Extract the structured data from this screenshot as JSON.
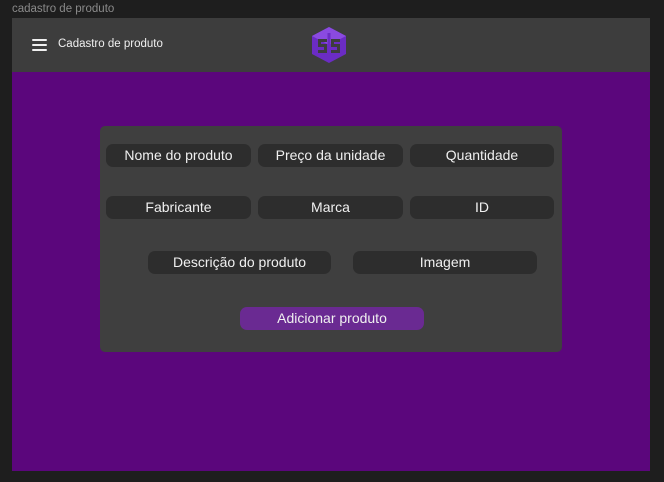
{
  "frame": {
    "title": "cadastro de produto"
  },
  "navbar": {
    "title": "Cadastro de produto",
    "menu_icon": "hamburger-menu-icon",
    "logo_icon": "brand-logo-icon",
    "background": "#3d3d3d"
  },
  "page": {
    "background": "#5b067c"
  },
  "form": {
    "fields": [
      {
        "label": "Nome do produto"
      },
      {
        "label": "Preço da unidade"
      },
      {
        "label": "Quantidade"
      },
      {
        "label": "Fabricante"
      },
      {
        "label": "Marca"
      },
      {
        "label": "ID"
      },
      {
        "label": "Descrição do produto"
      },
      {
        "label": "Imagem"
      }
    ],
    "submit_label": "Adicionar produto",
    "accent": "#6a2a92"
  }
}
